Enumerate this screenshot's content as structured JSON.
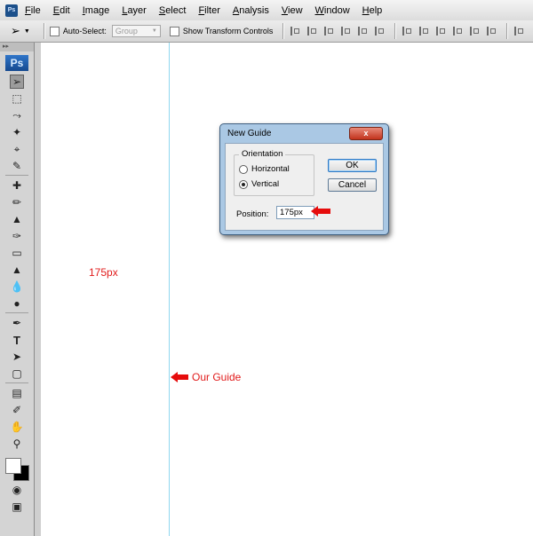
{
  "menubar": {
    "logo": "Ps",
    "items": [
      "File",
      "Edit",
      "Image",
      "Layer",
      "Select",
      "Filter",
      "Analysis",
      "View",
      "Window",
      "Help"
    ]
  },
  "options_bar": {
    "auto_select_label": "Auto-Select:",
    "auto_select_value": "Group",
    "transform_label": "Show Transform Controls"
  },
  "toolbox": {
    "logo": "Ps",
    "tools": [
      "move-icon",
      "marquee-icon",
      "lasso-icon",
      "magic-wand-icon",
      "crop-icon",
      "slice-icon",
      "healing-brush-icon",
      "brush-icon",
      "clone-stamp-icon",
      "history-brush-icon",
      "eraser-icon",
      "paint-bucket-icon",
      "blur-icon",
      "dodge-icon",
      "pen-icon",
      "type-icon",
      "path-selection-icon",
      "shape-icon",
      "notes-icon",
      "eyedropper-icon",
      "hand-icon",
      "zoom-icon"
    ]
  },
  "dialog": {
    "title": "New Guide",
    "close_label": "x",
    "orientation_label": "Orientation",
    "horizontal_label": "Horizontal",
    "vertical_label": "Vertical",
    "selected_orientation": "Vertical",
    "ok_label": "OK",
    "cancel_label": "Cancel",
    "position_label": "Position:",
    "position_value": "175px"
  },
  "annotations": {
    "distance_label": "175px",
    "guide_label": "Our Guide",
    "color": "#e60c0c"
  },
  "colors": {
    "guide": "#8fd8ef",
    "dialog_frame": "#aac8e4"
  }
}
